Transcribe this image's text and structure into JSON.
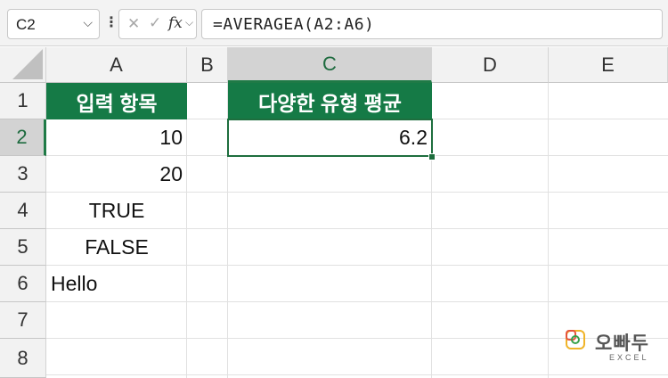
{
  "formula_bar": {
    "name_box": "C2",
    "cancel_icon": "✕",
    "enter_icon": "✓",
    "fx_label": "fx",
    "formula": "=AVERAGEA(A2:A6)"
  },
  "columns": [
    "A",
    "B",
    "C",
    "D",
    "E"
  ],
  "rows": [
    "1",
    "2",
    "3",
    "4",
    "5",
    "6",
    "7",
    "8"
  ],
  "active_cell": "C2",
  "cells": {
    "A1": "입력 항목",
    "A2": "10",
    "A3": "20",
    "A4": "TRUE",
    "A5": "FALSE",
    "A6": "Hello",
    "C1": "다양한 유형 평균",
    "C2": "6.2"
  },
  "colors": {
    "header_fill": "#157a46",
    "header_text": "#ffffff",
    "selection": "#1e6e3e"
  },
  "watermark": {
    "brand": "오빠두",
    "sub": "EXCEL"
  }
}
